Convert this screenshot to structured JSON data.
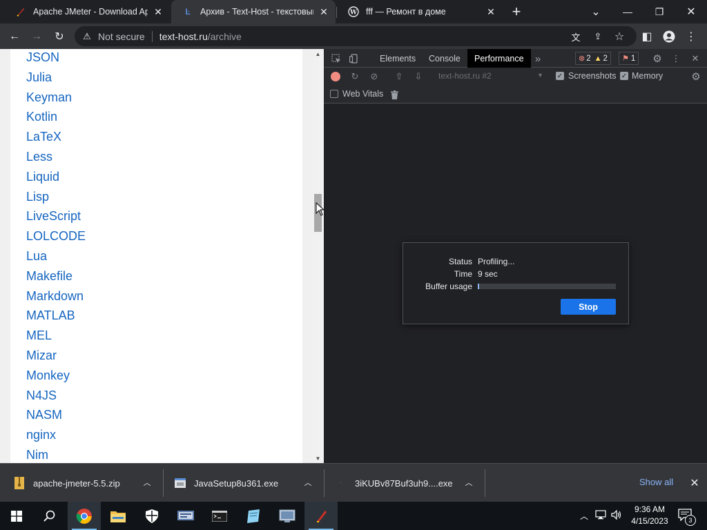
{
  "browser": {
    "tabs": [
      {
        "title": "Apache JMeter - Download Apac",
        "icon": "feather-icon",
        "active": false
      },
      {
        "title": "Архив - Text-Host - текстовый х",
        "icon": "text-host-icon",
        "active": true
      },
      {
        "title": "fff — Ремонт в доме",
        "icon": "wordpress-icon",
        "active": false
      }
    ],
    "new_tab": "+",
    "window_controls": {
      "minimize": "—",
      "restore": "❐",
      "close": "✕",
      "tab_search": "⌄"
    }
  },
  "toolbar": {
    "security_label": "Not secure",
    "url_host": "text-host.ru",
    "url_path": "/archive",
    "icons": {
      "back": "←",
      "forward": "→",
      "reload": "↻",
      "warning": "⚠",
      "translate": "文",
      "share": "⇪",
      "bookmark": "☆",
      "sidepanel": "◧",
      "profile": "●",
      "menu": "⋮"
    }
  },
  "page": {
    "languages": [
      "JSON",
      "Julia",
      "Keyman",
      "Kotlin",
      "LaTeX",
      "Less",
      "Liquid",
      "Lisp",
      "LiveScript",
      "LOLCODE",
      "Lua",
      "Makefile",
      "Markdown",
      "MATLAB",
      "MEL",
      "Mizar",
      "Monkey",
      "N4JS",
      "NASM",
      "nginx",
      "Nim"
    ],
    "scroll_up": "▲",
    "scroll_down": "▼"
  },
  "devtools": {
    "tabs": [
      "Elements",
      "Console",
      "Performance"
    ],
    "active_tab": "Performance",
    "more": "»",
    "errors": "2",
    "warnings": "2",
    "issues": "1",
    "target": "text-host.ru #2",
    "screenshots_label": "Screenshots",
    "memory_label": "Memory",
    "web_vitals_label": "Web Vitals",
    "checks": {
      "screenshots": true,
      "memory": true,
      "web_vitals": false
    },
    "recording": {
      "status_label": "Status",
      "status_value": "Profiling...",
      "time_label": "Time",
      "time_value": "9 sec",
      "buffer_label": "Buffer usage",
      "buffer_fraction": 0.01,
      "stop_label": "Stop"
    }
  },
  "downloads": {
    "items": [
      {
        "name": "apache-jmeter-5.5.zip",
        "icon": "zip-file-icon"
      },
      {
        "name": "JavaSetup8u361.exe",
        "icon": "exe-file-icon"
      },
      {
        "name": "3iKUBv87Buf3uh9....exe",
        "icon": "file-icon"
      }
    ],
    "show_all": "Show all",
    "close": "✕"
  },
  "taskbar": {
    "time": "9:36 AM",
    "date": "4/15/2023",
    "notifications": "3",
    "apps": [
      "start",
      "search",
      "chrome",
      "file-explorer",
      "defender",
      "app-network",
      "terminal",
      "notepad-app",
      "remote-desktop",
      "jmeter"
    ]
  },
  "colors": {
    "accent": "#1a73e8",
    "link": "#1565c0",
    "record": "#f28b82"
  }
}
